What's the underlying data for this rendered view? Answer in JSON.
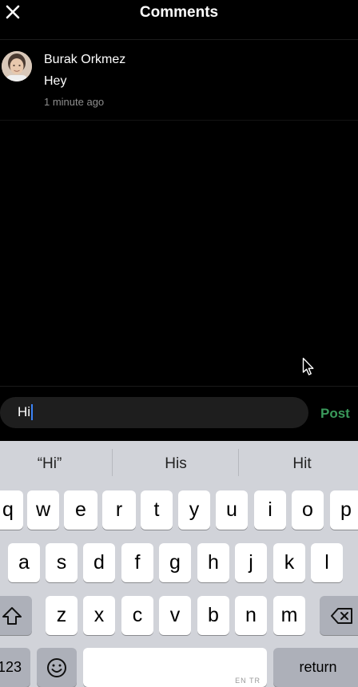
{
  "header": {
    "title": "Comments",
    "close_icon": "close-icon"
  },
  "comment": {
    "author": "Burak Orkmez",
    "text": "Hey",
    "timestamp": "1 minute ago",
    "avatar_icon": "avatar"
  },
  "composer": {
    "input_value": "Hi",
    "post_label": "Post",
    "post_color": "#3a9a5b"
  },
  "keyboard": {
    "suggestions": [
      "“Hi”",
      "His",
      "Hit"
    ],
    "row1": [
      "q",
      "w",
      "e",
      "r",
      "t",
      "y",
      "u",
      "i",
      "o",
      "p"
    ],
    "row2": [
      "a",
      "s",
      "d",
      "f",
      "g",
      "h",
      "j",
      "k",
      "l"
    ],
    "row3": [
      "z",
      "x",
      "c",
      "v",
      "b",
      "n",
      "m"
    ],
    "numbers_label": "123",
    "return_label": "return",
    "space_hint": "EN TR",
    "shift_icon": "shift-icon",
    "backspace_icon": "backspace-icon",
    "emoji_icon": "emoji-icon"
  },
  "colors": {
    "background": "#000000",
    "keyboard_bg": "#d1d3d9",
    "accent_caret": "#3b82f6"
  }
}
